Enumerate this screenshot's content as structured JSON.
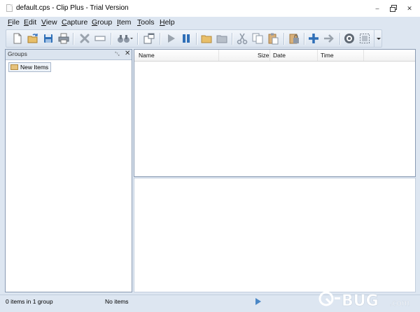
{
  "window": {
    "title": "default.cps - Clip Plus - Trial Version",
    "controls": [
      "minimize",
      "restore",
      "close"
    ]
  },
  "menu": [
    {
      "label": "File",
      "mnemonic": "F"
    },
    {
      "label": "Edit",
      "mnemonic": "E"
    },
    {
      "label": "View",
      "mnemonic": "V"
    },
    {
      "label": "Capture",
      "mnemonic": "C"
    },
    {
      "label": "Group",
      "mnemonic": "G"
    },
    {
      "label": "Item",
      "mnemonic": "I"
    },
    {
      "label": "Tools",
      "mnemonic": "T"
    },
    {
      "label": "Help",
      "mnemonic": "H"
    }
  ],
  "toolbar": {
    "buttons": [
      "new-file",
      "open",
      "save",
      "print",
      "delete",
      "rename",
      "find",
      "capture-window",
      "play",
      "pause",
      "folder-open",
      "folder",
      "cut",
      "copy",
      "paste",
      "lock",
      "add",
      "forward",
      "settings",
      "select-region",
      "more"
    ]
  },
  "groups_panel": {
    "title": "Groups",
    "items": [
      {
        "label": "New Items"
      }
    ]
  },
  "item_list": {
    "columns": [
      "Name",
      "Size",
      "Date",
      "Time"
    ],
    "rows": []
  },
  "statusbar": {
    "items_info": "0 items in 1 group",
    "selection_info": "No items"
  },
  "watermark": "Q-BUG.com"
}
